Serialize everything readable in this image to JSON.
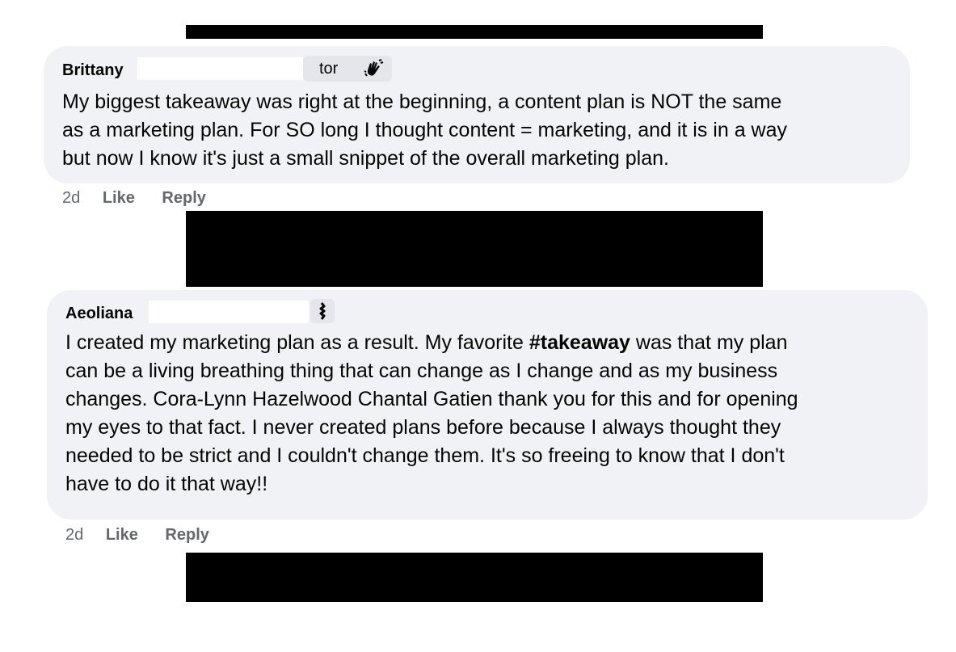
{
  "comments": [
    {
      "author": "Brittany",
      "badge_text": "tor",
      "badge_icon": "waving-hand-icon",
      "lines": [
        "My biggest takeaway was right at the beginning, a content plan is NOT the same",
        "as a marketing plan. For SO long I thought content = marketing, and it is in a way",
        "but now I know it's just a small snippet of the overall marketing plan."
      ],
      "time": "2d",
      "like_label": "Like",
      "reply_label": "Reply"
    },
    {
      "author": "Aeoliana",
      "badge_icon": "badge-icon",
      "lines": [
        {
          "before": "I created my marketing plan as a result. My favorite ",
          "hashtag": "#takeaway",
          "after": " was that my plan"
        },
        "can be a living breathing thing that can change as I change and as my business",
        "changes. Cora-Lynn Hazelwood Chantal Gatien thank you for this and for opening",
        "my eyes to that fact. I never created plans before because I always thought they",
        "needed to be strict and I couldn't change them. It's so freeing to know that I don't",
        "have to do it that way!!"
      ],
      "time": "2d",
      "like_label": "Like",
      "reply_label": "Reply"
    }
  ]
}
